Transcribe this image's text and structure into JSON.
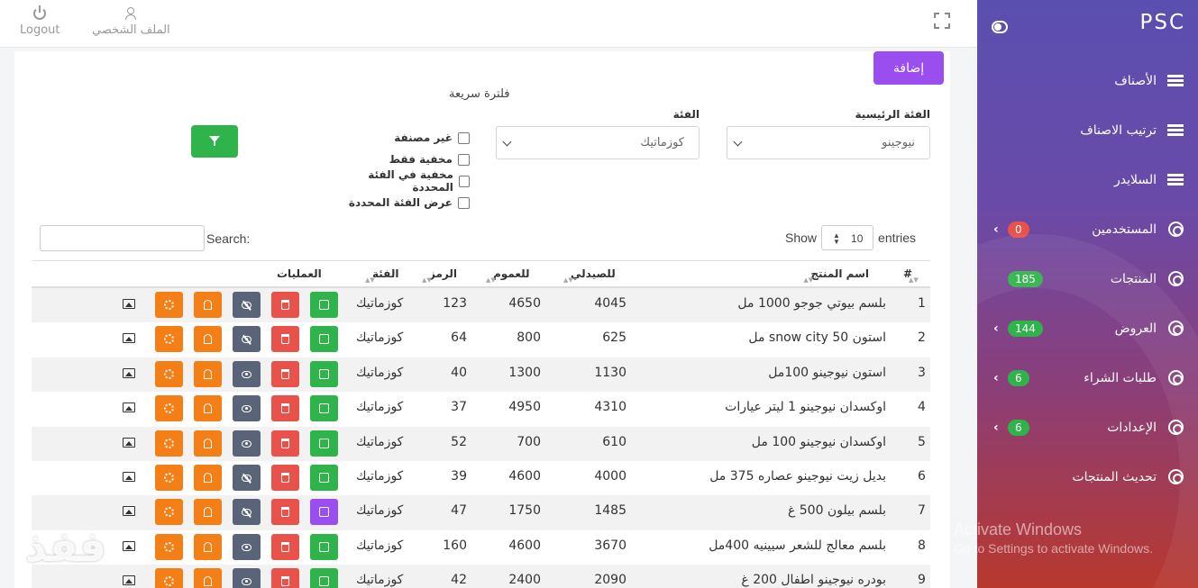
{
  "brand": "PSC",
  "topbar": {
    "logout": "Logout",
    "profile": "الملف الشخصي"
  },
  "sidebar": {
    "items": [
      {
        "label": "الأصناف",
        "icon": "list-icon"
      },
      {
        "label": "ترتيب الاصناف",
        "icon": "list-icon"
      },
      {
        "label": "السلايدر",
        "icon": "list-icon"
      },
      {
        "label": "المستخدمين",
        "icon": "aperture-icon",
        "badge": "0",
        "badge_color": "#e8524a",
        "chevron": "›"
      },
      {
        "label": "المنتجات",
        "icon": "aperture-icon",
        "badge": "185",
        "badge_color": "#2fb34b"
      },
      {
        "label": "العروض",
        "icon": "aperture-icon",
        "badge": "144",
        "badge_color": "#2fb34b",
        "chevron": "›"
      },
      {
        "label": "طلبات الشراء",
        "icon": "aperture-icon",
        "badge": "6",
        "badge_color": "#2fb34b",
        "chevron": "›"
      },
      {
        "label": "الإعدادات",
        "icon": "aperture-icon",
        "badge": "6",
        "badge_color": "#2fb34b",
        "chevron": "›"
      },
      {
        "label": "تحديث المنتجات",
        "icon": "aperture-icon"
      }
    ]
  },
  "windows_notice": {
    "title": "Activate Windows",
    "subtitle": "Go to Settings to activate Windows."
  },
  "main": {
    "add_label": "إضافة",
    "quick_filter": "فلترة سريعة",
    "main_category_label": "الفئة الرئيسية",
    "main_category_value": "نيوجينو",
    "category_label": "الفئة",
    "category_value": "كوزماتيك",
    "checkboxes": [
      "غير مصنفة",
      "مخفية فقط",
      "مخفية في الفئة المحددة",
      "عرض الفئة المحددة"
    ],
    "show": "Show",
    "entries_value": "10",
    "entries": "entries",
    "search_label": "Search:"
  },
  "table": {
    "headers": {
      "num": "#",
      "name": "اسم المنتج",
      "pharmacist": "للصيدلي",
      "public": "للعموم",
      "code": "الرمز",
      "category": "الفئة",
      "operations": "العمليات"
    },
    "rows": [
      {
        "num": "1",
        "name": "بلسم بيوتي جوجو 1000 مل",
        "pharmacist": "4045",
        "public": "4650",
        "code": "123",
        "category": "كوزماتيك",
        "edit_color": "green",
        "eye": "slash"
      },
      {
        "num": "2",
        "name": "استون snow city 50 مل",
        "pharmacist": "625",
        "public": "800",
        "code": "64",
        "category": "كوزماتيك",
        "edit_color": "green",
        "eye": "slash"
      },
      {
        "num": "3",
        "name": "استون نيوجينو 100مل",
        "pharmacist": "1130",
        "public": "1300",
        "code": "40",
        "category": "كوزماتيك",
        "edit_color": "green",
        "eye": "open"
      },
      {
        "num": "4",
        "name": "اوكسدان نيوجينو 1 ليتر عيارات",
        "pharmacist": "4310",
        "public": "4950",
        "code": "37",
        "category": "كوزماتيك",
        "edit_color": "green",
        "eye": "open"
      },
      {
        "num": "5",
        "name": "اوكسدان نيوجينو 100 مل",
        "pharmacist": "610",
        "public": "700",
        "code": "52",
        "category": "كوزماتيك",
        "edit_color": "green",
        "eye": "open"
      },
      {
        "num": "6",
        "name": "بديل زيت نيوجينو عصاره 375 مل",
        "pharmacist": "4000",
        "public": "4600",
        "code": "39",
        "category": "كوزماتيك",
        "edit_color": "green",
        "eye": "slash"
      },
      {
        "num": "7",
        "name": "بلسم بيلون 500 غ",
        "pharmacist": "1485",
        "public": "1750",
        "code": "47",
        "category": "كوزماتيك",
        "edit_color": "purple",
        "eye": "slash"
      },
      {
        "num": "8",
        "name": "بلسم معالج للشعر سيينيه 400مل",
        "pharmacist": "3670",
        "public": "4600",
        "code": "160",
        "category": "كوزماتيك",
        "edit_color": "green",
        "eye": "open"
      },
      {
        "num": "9",
        "name": "بودره نيوجينو اطفال 200 غ",
        "pharmacist": "2090",
        "public": "2400",
        "code": "42",
        "category": "كوزماتيك",
        "edit_color": "green",
        "eye": "open"
      }
    ]
  },
  "watermark": "ففذ"
}
